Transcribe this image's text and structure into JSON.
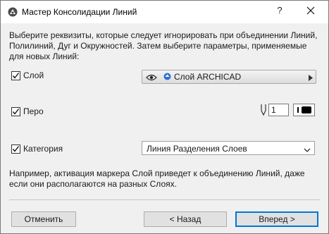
{
  "window": {
    "title": "Мастер Консолидации Линий",
    "help_label": "?",
    "close_icon": "close-icon",
    "app_icon": "archicad-logo-icon"
  },
  "instructions": "Выберите реквизиты, которые следует игнорировать при объединении Линий, Полилиний, Дуг и Окружностей. Затем выберите параметры, применяемые для новых Линий:",
  "layer": {
    "label": "Слой",
    "checked": true,
    "value": "Слой ARCHICAD",
    "eye_icon": "eye-icon",
    "layer_icon": "layer-icon",
    "arrow_icon": "arrow-right-icon"
  },
  "pen": {
    "label": "Перо",
    "checked": true,
    "value": "1",
    "pen_icon": "pen-icon",
    "swatch_color": "#000000"
  },
  "category": {
    "label": "Категория",
    "checked": true,
    "value": "Линия Разделения Слоев",
    "chevron_icon": "chevron-down-icon"
  },
  "hint": "Например, активация маркера Слой приведет к объединению Линий, даже если они располагаются на разных Слоях.",
  "buttons": {
    "cancel": "Отменить",
    "back": "< Назад",
    "next": "Вперед >"
  },
  "colors": {
    "background": "#f0f0f0",
    "titlebar": "#ffffff",
    "primary_border": "#0078d7"
  }
}
